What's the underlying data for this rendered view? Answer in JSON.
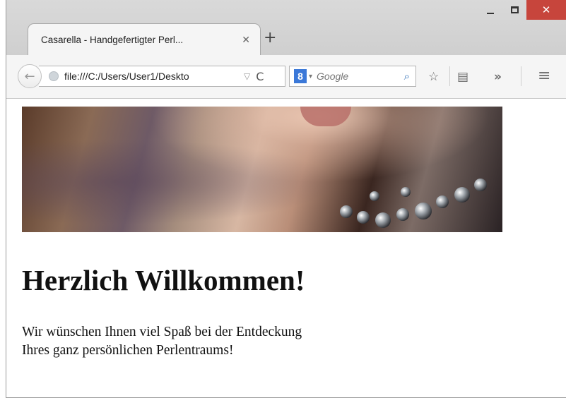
{
  "browser": {
    "tab": {
      "title": "Casarella - Handgefertigter Perl...",
      "close_glyph": "✕"
    },
    "new_tab_glyph": "+",
    "window_controls": {
      "minimize": "",
      "maximize": "",
      "close": "✕"
    },
    "nav": {
      "back_glyph": "←",
      "url": "file:///C:/Users/User1/Deskto",
      "dropdown_glyph": "▽",
      "reload_glyph": "C",
      "search_engine_letter": "8",
      "search_dropdown_glyph": "▾",
      "search_placeholder": "Google",
      "search_glyph": "⌕",
      "bookmark_glyph": "☆",
      "reading_list_glyph": "▤",
      "overflow_glyph": "»",
      "menu_glyph": "≡"
    },
    "accent": "#c7453c"
  },
  "page": {
    "heading": "Herzlich Willkommen!",
    "paragraph_line1": "Wir wünschen Ihnen viel Spaß bei der Entdeckung",
    "paragraph_line2": "Ihres ganz persönlichen Perlentraums!"
  }
}
